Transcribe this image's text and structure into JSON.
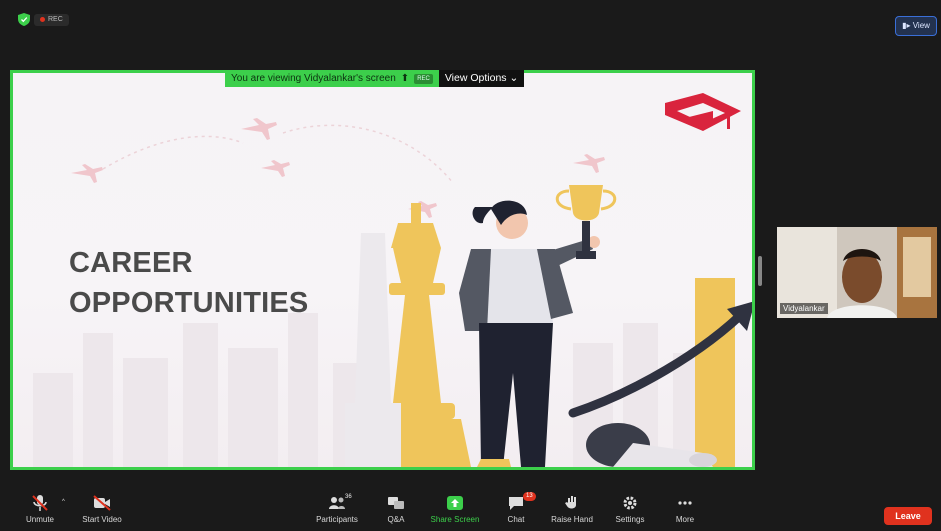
{
  "top": {
    "rec": "REC",
    "view": "View"
  },
  "share": {
    "banner_text": "You are viewing Vidyalankar's screen",
    "banner_rec": "REC",
    "view_options": "View Options ⌄"
  },
  "slide": {
    "title_line1": "CAREER",
    "title_line2": "OPPORTUNITIES"
  },
  "participant": {
    "name": "Vidyalankar"
  },
  "toolbar": {
    "unmute": "Unmute",
    "start_video": "Start Video",
    "participants": "Participants",
    "participants_count": "36",
    "qa": "Q&A",
    "share_screen": "Share Screen",
    "chat": "Chat",
    "chat_count": "13",
    "raise_hand": "Raise Hand",
    "settings": "Settings",
    "more": "More",
    "leave": "Leave"
  },
  "colors": {
    "accent_green": "#3ccf4b",
    "leave_red": "#e0321e",
    "logo_red": "#d9243d",
    "chess_gold": "#efc55b"
  }
}
